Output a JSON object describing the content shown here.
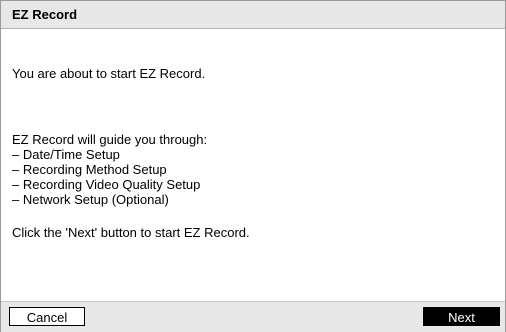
{
  "dialog": {
    "title": "EZ Record",
    "intro": "You are about to start EZ Record.",
    "guide_heading": "EZ Record will guide you through:",
    "guide_items": [
      "– Date/Time Setup",
      "– Recording Method Setup",
      "– Recording Video Quality Setup",
      "– Network Setup (Optional)"
    ],
    "outro": "Click the 'Next' button to start EZ Record."
  },
  "buttons": {
    "cancel_label": "Cancel",
    "next_label": "Next"
  },
  "colors": {
    "title_bar_bg": "#e8e8e8",
    "primary_button_bg": "#000000",
    "primary_button_text": "#ffffff"
  }
}
